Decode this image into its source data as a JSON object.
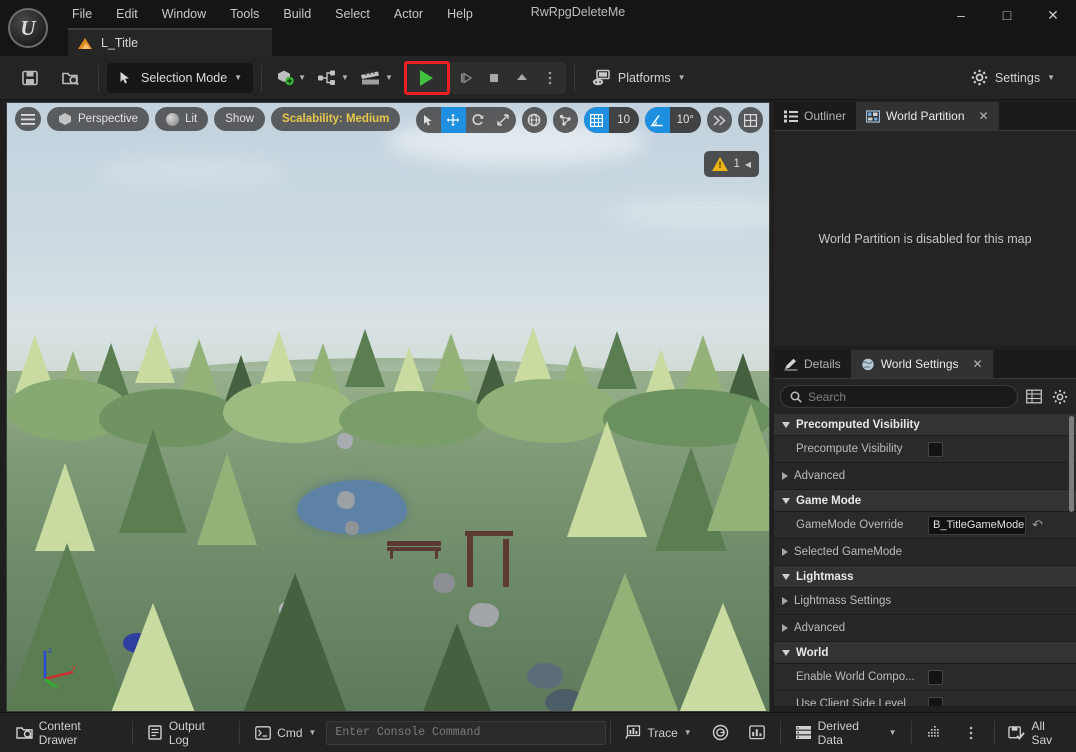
{
  "window": {
    "title": "RwRpgDeleteMe",
    "minimize": "–",
    "maximize": "□",
    "close": "✕"
  },
  "menubar": {
    "items": [
      "File",
      "Edit",
      "Window",
      "Tools",
      "Build",
      "Select",
      "Actor",
      "Help"
    ]
  },
  "level_tab": {
    "label": "L_Title"
  },
  "toolbar": {
    "save_tooltip": "Save",
    "browse_tooltip": "Browse",
    "mode_label": "Selection Mode",
    "platforms_label": "Platforms",
    "settings_label": "Settings",
    "play_label": "Play",
    "highlight_color": "#ec2024",
    "play_color": "#3fc33f"
  },
  "viewport": {
    "menu_icon": "hamburger-icon",
    "perspective": "Perspective",
    "lit": "Lit",
    "show": "Show",
    "scalability": "Scalability: Medium",
    "scalability_color": "#e7c74a",
    "grid_snap_value": "10",
    "angle_snap_value": "10°",
    "warning_count": "1",
    "accent_blue": "#1f8fe0"
  },
  "outliner_panel": {
    "tabs": [
      {
        "label": "Outliner",
        "icon": "outliner-icon",
        "active": false,
        "closable": false
      },
      {
        "label": "World Partition",
        "icon": "world-partition-icon",
        "active": true,
        "closable": true
      }
    ],
    "message": "World Partition is disabled for this map",
    "close_glyph": "✕"
  },
  "details_panel": {
    "tabs": [
      {
        "label": "Details",
        "icon": "details-pencil-icon",
        "active": false,
        "closable": false
      },
      {
        "label": "World Settings",
        "icon": "world-settings-icon",
        "active": true,
        "closable": true
      }
    ],
    "close_glyph": "✕",
    "search_placeholder": "Search",
    "search_value": "",
    "column_icon": "columns-icon",
    "settings_icon": "gear-icon",
    "rows": [
      {
        "kind": "category",
        "label": "Precomputed Visibility",
        "expanded": true
      },
      {
        "kind": "prop",
        "label": "Precompute Visibility",
        "control": "checkbox",
        "checked": false
      },
      {
        "kind": "subcat",
        "label": "Advanced",
        "expanded": false
      },
      {
        "kind": "category",
        "label": "Game Mode",
        "expanded": true
      },
      {
        "kind": "prop",
        "label": "GameMode Override",
        "control": "combo",
        "value": "B_TitleGameMode",
        "revert": true
      },
      {
        "kind": "subcat",
        "label": "Selected GameMode",
        "expanded": false
      },
      {
        "kind": "category",
        "label": "Lightmass",
        "expanded": true
      },
      {
        "kind": "subcat",
        "label": "Lightmass Settings",
        "expanded": false
      },
      {
        "kind": "subcat",
        "label": "Advanced",
        "expanded": false
      },
      {
        "kind": "category",
        "label": "World",
        "expanded": true
      },
      {
        "kind": "prop",
        "label": "Enable World Compo...",
        "control": "checkbox",
        "checked": false
      },
      {
        "kind": "prop",
        "label": "Use Client Side Level",
        "control": "checkbox",
        "checked": false
      }
    ]
  },
  "statusbar": {
    "content_drawer": "Content Drawer",
    "output_log": "Output Log",
    "cmd": "Cmd",
    "console_placeholder": "Enter Console Command",
    "trace": "Trace",
    "derived_data": "Derived Data",
    "all_saved": "All Sav"
  }
}
